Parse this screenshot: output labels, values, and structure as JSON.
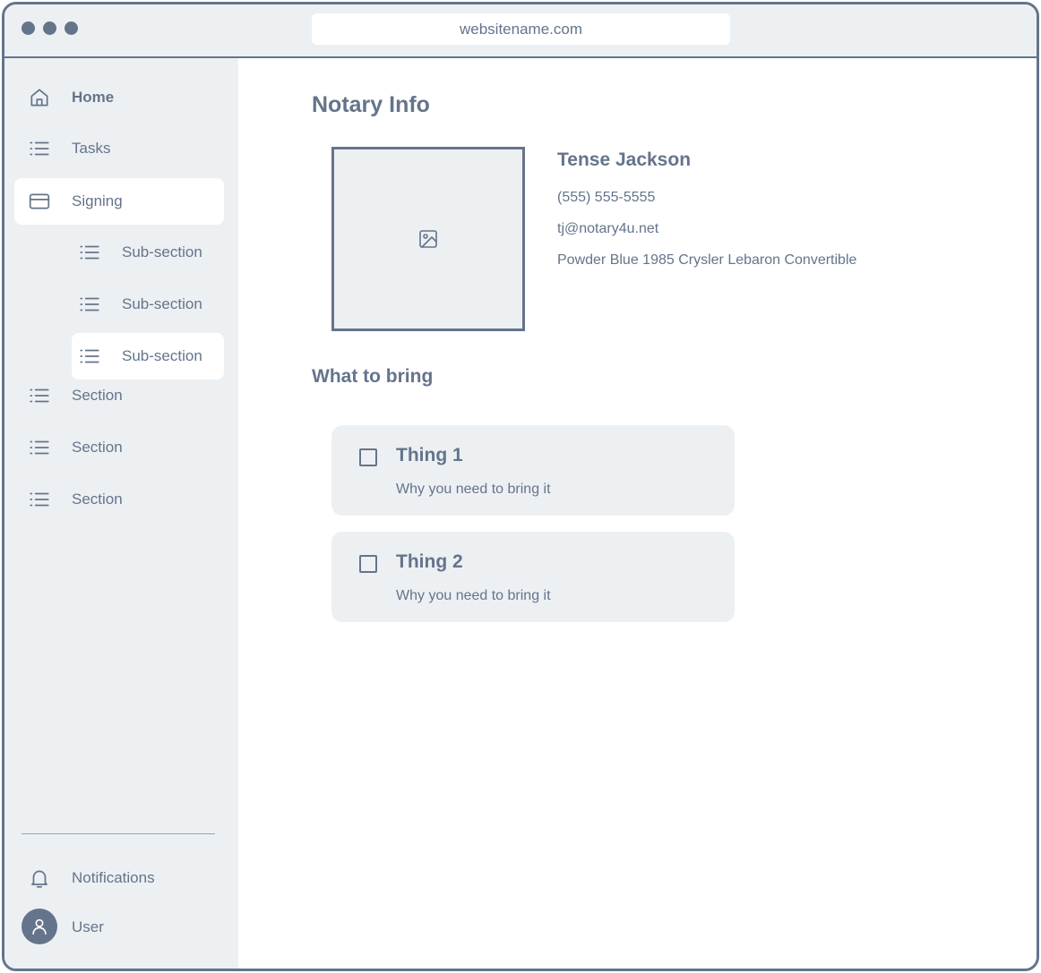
{
  "browser": {
    "url": "websitename.com"
  },
  "sidebar": {
    "items": [
      {
        "label": "Home",
        "icon": "home-icon"
      },
      {
        "label": "Tasks",
        "icon": "list-icon"
      },
      {
        "label": "Signing",
        "icon": "card-icon",
        "active": true
      },
      {
        "label": "Sub-section",
        "icon": "list-icon"
      },
      {
        "label": "Sub-section",
        "icon": "list-icon"
      },
      {
        "label": "Sub-section",
        "icon": "list-icon",
        "active": true
      },
      {
        "label": "Section",
        "icon": "list-icon"
      },
      {
        "label": "Section",
        "icon": "list-icon"
      },
      {
        "label": "Section",
        "icon": "list-icon"
      }
    ],
    "notifications_label": "Notifications",
    "user_label": "User"
  },
  "main": {
    "title": "Notary Info",
    "notary": {
      "name": "Tense Jackson",
      "phone": "(555) 555-5555",
      "email": "tj@notary4u.net",
      "vehicle": "Powder Blue 1985 Crysler Lebaron Convertible"
    },
    "bring_title": "What to bring",
    "things": [
      {
        "title": "Thing 1",
        "description": "Why you need to bring it",
        "checked": false
      },
      {
        "title": "Thing 2",
        "description": "Why you need to bring it",
        "checked": false
      }
    ]
  },
  "colors": {
    "primary": "#64748b",
    "panel": "#edf0f3",
    "background": "#ffffff"
  }
}
